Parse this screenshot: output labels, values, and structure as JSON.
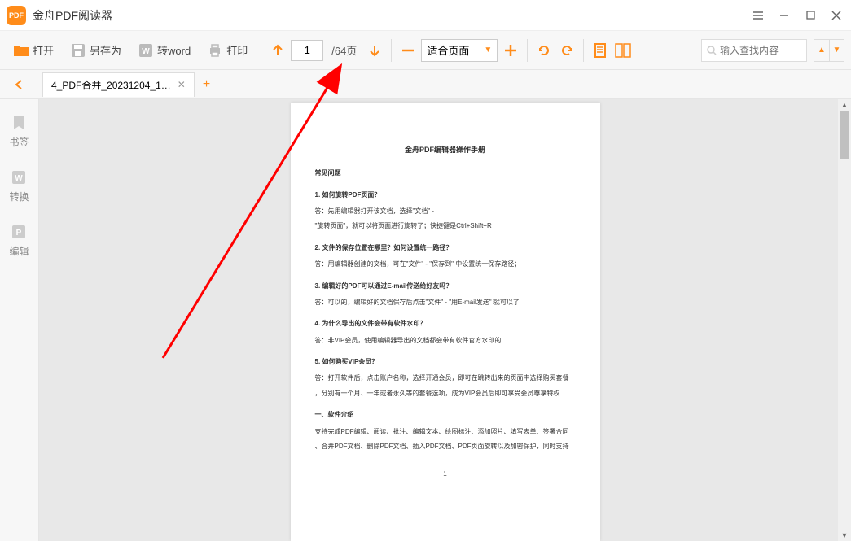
{
  "app": {
    "title": "金舟PDF阅读器",
    "logo_text": "PDF"
  },
  "toolbar": {
    "open": "打开",
    "save_as": "另存为",
    "to_word": "转word",
    "print": "打印",
    "page_current": "1",
    "page_total": "/64页",
    "zoom_label": "适合页面",
    "search_placeholder": "输入查找内容"
  },
  "tabs": {
    "current": "4_PDF合并_20231204_1…"
  },
  "sidebar": {
    "bookmark": "书签",
    "convert": "转换",
    "edit": "编辑"
  },
  "document": {
    "title": "金舟PDF编辑器操作手册",
    "faq_header": "常见问题",
    "q1": "1. 如何旋转PDF页面？",
    "a1_1": "答：先用编辑器打开该文档，选择\"文档\" -",
    "a1_2": "\"旋转页面\"，就可以将页面进行旋转了；快捷键是Ctrl+Shift+R",
    "q2": "2. 文件的保存位置在哪里？如何设置统一路径？",
    "a2": "答：用编辑器创建的文档，可在\"文件\" - \"保存到\" 中设置统一保存路径；",
    "q3": "3. 编辑好的PDF可以通过E-mail传送给好友吗？",
    "a3": "答：可以的，编辑好的文档保存后点击\"文件\" - \"用E-mail发送\" 就可以了",
    "q4": "4. 为什么导出的文件会带有软件水印？",
    "a4": "答：非VIP会员，使用编辑器导出的文档都会带有软件官方水印的",
    "q5": "5. 如何购买VIP会员？",
    "a5_1": "答：打开软件后，点击账户名称，选择开通会员，即可在跳转出来的页面中选择购买套餐",
    "a5_2": "，分别有一个月、一年或者永久等的套餐选项，成为VIP会员后即可享受会员尊享特权",
    "intro_header": "一、软件介绍",
    "intro_1": "支持完成PDF编辑、阅读、批注、编辑文本、绘图标注、添加照片、填写表单、签署合同",
    "intro_2": "、合并PDF文档、删除PDF文档、插入PDF文档、PDF页面旋转以及加密保护，同时支持",
    "page_number": "1"
  }
}
